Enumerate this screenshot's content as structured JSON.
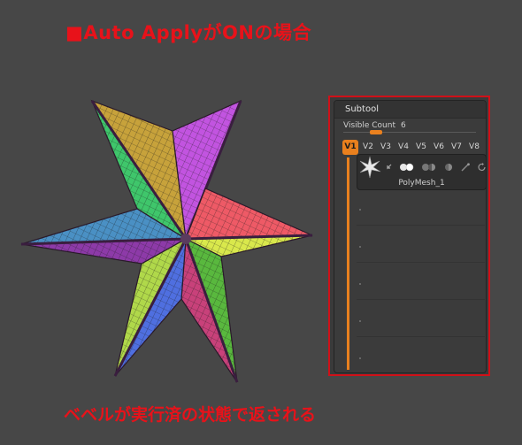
{
  "annotation": {
    "title": "■Auto ApplyがONの場合",
    "caption": "ベベルが実行済の状態で返される",
    "color": "#e8121a"
  },
  "subtool_panel": {
    "header": "Subtool",
    "visible_count_label": "Visible Count",
    "visible_count_value": "6",
    "accent": "#e9801e",
    "tabs": [
      "V1",
      "V2",
      "V3",
      "V4",
      "V5",
      "V6",
      "V7",
      "V8"
    ],
    "active_tab": "V1",
    "subtool": {
      "name": "PolyMesh_1",
      "icons": [
        "arrow-icon",
        "visibility-toggle-icon",
        "half-moon-icon",
        "sphere-icon",
        "brush-icon",
        "refresh-icon"
      ]
    }
  },
  "viewport": {
    "object": "six-pointed-star-mesh",
    "face_colors": [
      "#3fc66b",
      "#c7a23b",
      "#c254e0",
      "#44b7c4",
      "#ee5a66",
      "#d9e84c",
      "#59b83e",
      "#c8417a",
      "#4f6fe0",
      "#b0d84a",
      "#8d3aa8",
      "#4a90c4"
    ]
  }
}
